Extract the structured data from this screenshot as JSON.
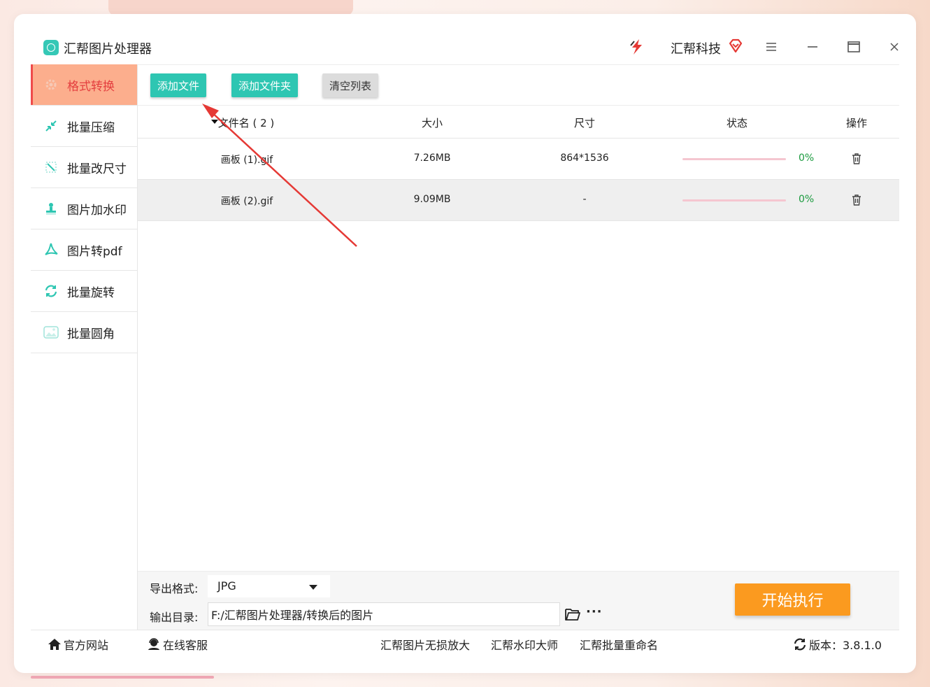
{
  "app": {
    "title": "汇帮图片处理器",
    "brand": "汇帮科技"
  },
  "sidebar": {
    "items": [
      {
        "label": "格式转换",
        "icon": "gear-icon",
        "active": true
      },
      {
        "label": "批量压缩",
        "icon": "compress-icon"
      },
      {
        "label": "批量改尺寸",
        "icon": "resize-icon"
      },
      {
        "label": "图片加水印",
        "icon": "stamp-icon"
      },
      {
        "label": "图片转pdf",
        "icon": "pdf-icon"
      },
      {
        "label": "批量旋转",
        "icon": "rotate-icon"
      },
      {
        "label": "批量圆角",
        "icon": "image-icon"
      }
    ]
  },
  "toolbar": {
    "add_file": "添加文件",
    "add_folder": "添加文件夹",
    "clear_list": "清空列表"
  },
  "table": {
    "headers": {
      "name": "文件名 ( 2 )",
      "size": "大小",
      "dimensions": "尺寸",
      "status": "状态",
      "actions": "操作"
    },
    "rows": [
      {
        "name": "画板 (1).gif",
        "size": "7.26MB",
        "dimensions": "864*1536",
        "progress": "0%"
      },
      {
        "name": "画板 (2).gif",
        "size": "9.09MB",
        "dimensions": "-",
        "progress": "0%"
      }
    ]
  },
  "export": {
    "format_label": "导出格式:",
    "format_value": "JPG",
    "dir_label": "输出目录:",
    "dir_value": "F:/汇帮图片处理器/转换后的图片",
    "more": "···",
    "start": "开始执行"
  },
  "footer": {
    "website": "官方网站",
    "support": "在线客服",
    "links": [
      "汇帮图片无损放大",
      "汇帮水印大师",
      "汇帮批量重命名"
    ],
    "version": "版本：3.8.1.0"
  },
  "colors": {
    "accent": "#2ec6b2",
    "active_bg": "#fcae8d",
    "start": "#fb9a1f",
    "progress_text": "#1a9a3e"
  }
}
